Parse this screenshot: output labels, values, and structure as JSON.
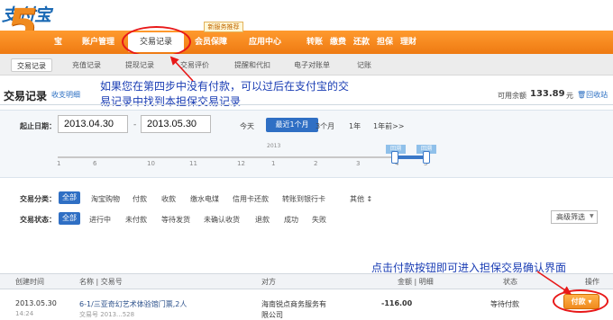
{
  "brand": {
    "logo_text": "支付宝",
    "step_number": "5"
  },
  "nav": {
    "new_badge": "新服务推荐",
    "items": [
      {
        "label": "宝"
      },
      {
        "label": "账户管理"
      },
      {
        "label": "交易记录"
      },
      {
        "label": "会员保障"
      },
      {
        "label": "应用中心"
      }
    ],
    "right_items": [
      {
        "label": "转账"
      },
      {
        "label": "缴费"
      },
      {
        "label": "还款"
      },
      {
        "label": "担保"
      },
      {
        "label": "理财"
      }
    ]
  },
  "subnav": {
    "items": [
      {
        "label": "交易记录"
      },
      {
        "label": "充值记录"
      },
      {
        "label": "提现记录"
      },
      {
        "label": "交易评价"
      },
      {
        "label": "提醒和代扣"
      },
      {
        "label": "电子对账单"
      },
      {
        "label": "记账"
      }
    ]
  },
  "header": {
    "title": "交易记录",
    "title_link": "收支明细",
    "balance_label": "可用余额",
    "balance_value": "133.89",
    "balance_unit": "元",
    "recycle_link": "回收站"
  },
  "annotations": {
    "top": "如果您在第四步中没有付款，可以过后在支付宝的交易记录中找到本担保交易记录",
    "bottom": "点击付款按钮即可进入担保交易确认界面"
  },
  "date_filter": {
    "label": "起止日期：",
    "start": "2013.04.30",
    "end": "2013.05.30",
    "ranges": [
      {
        "label": "今天"
      },
      {
        "label": "最近1个月"
      },
      {
        "label": "3个月"
      },
      {
        "label": "1年"
      },
      {
        "label": "1年前>>"
      }
    ],
    "year_mark": "2013",
    "ticks": [
      "1",
      "6",
      "10",
      "11",
      "12",
      "1",
      "2",
      "3",
      "4",
      "5"
    ],
    "handle_labels": [
      "回溯",
      "回溯"
    ]
  },
  "category_filter": {
    "label": "交易分类：",
    "options": [
      "全部",
      "淘宝购物",
      "付款",
      "收款",
      "缴水电煤",
      "信用卡还款",
      "转账到银行卡",
      "其他 ↕"
    ]
  },
  "status_filter": {
    "label": "交易状态：",
    "options": [
      "全部",
      "进行中",
      "未付款",
      "等待发货",
      "未确认收货",
      "退款",
      "成功",
      "失败"
    ],
    "advanced": "高级筛选"
  },
  "table": {
    "headers": [
      "创建时间",
      "名称 | 交易号",
      "对方",
      "金额 | 明细",
      "状态",
      "操作"
    ],
    "rows": [
      {
        "date": "2013.05.30",
        "time": "14:24",
        "name": "6-1/三亚奇幻艺术体验馆门票,2人",
        "trade_no": "交易号 2013...528",
        "counterparty_line1": "海南锐点商务服务有",
        "counterparty_line2": "限公司",
        "amount": "-116.00",
        "status": "等待付款",
        "action": "付款 ▾"
      }
    ]
  },
  "colors": {
    "nav_orange": "#f08a1e",
    "link_blue": "#2a6ec2",
    "annotation_blue": "#1a3db4",
    "highlight_red": "#e81818"
  }
}
